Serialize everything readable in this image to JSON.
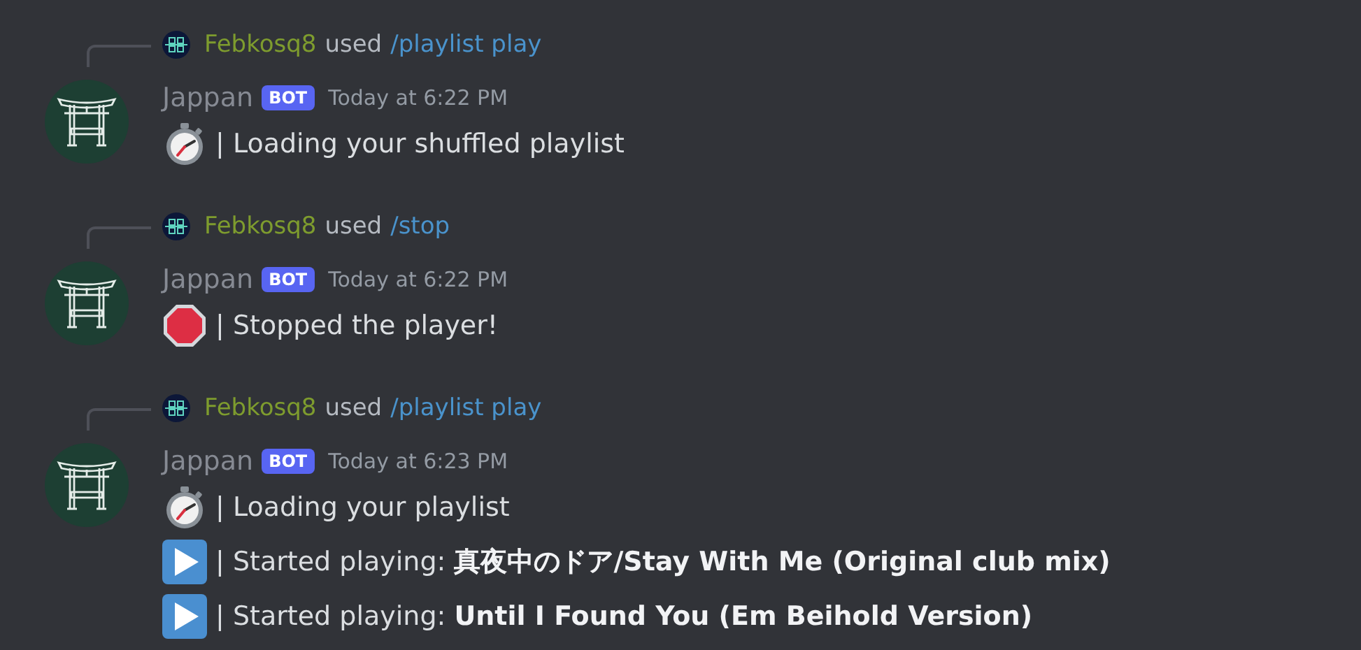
{
  "messages": [
    {
      "reply": {
        "user": "Febkosq8",
        "verb": "used",
        "command": "/playlist play"
      },
      "author": "Jappan",
      "badge": "BOT",
      "timestamp": "Today at 6:22 PM",
      "lines": [
        {
          "kind": "stopwatch",
          "text": "| Loading your shuffled playlist"
        }
      ]
    },
    {
      "reply": {
        "user": "Febkosq8",
        "verb": "used",
        "command": "/stop"
      },
      "author": "Jappan",
      "badge": "BOT",
      "timestamp": "Today at 6:22 PM",
      "lines": [
        {
          "kind": "stop",
          "text": "| Stopped the player!"
        }
      ]
    },
    {
      "reply": {
        "user": "Febkosq8",
        "verb": "used",
        "command": "/playlist play"
      },
      "author": "Jappan",
      "badge": "BOT",
      "timestamp": "Today at 6:23 PM",
      "lines": [
        {
          "kind": "stopwatch",
          "text": "| Loading your playlist"
        },
        {
          "kind": "play",
          "text": "| Started playing: **真夜中のドア/Stay With Me (Original club mix)**"
        },
        {
          "kind": "play",
          "text": "| Started playing: **Until I Found You (Em Beihold Version)**"
        }
      ]
    }
  ]
}
